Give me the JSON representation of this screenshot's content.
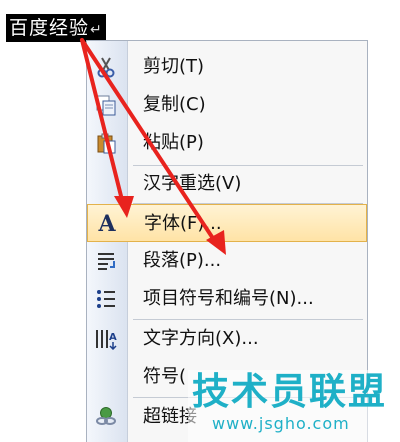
{
  "document": {
    "selected_text": "百度经验",
    "paragraph_mark": "↵"
  },
  "context_menu": {
    "items": [
      {
        "label": "剪切(T)",
        "icon": "scissors-icon"
      },
      {
        "label": "复制(C)",
        "icon": "copy-icon"
      },
      {
        "label": "粘贴(P)",
        "icon": "paste-icon"
      },
      {
        "label": "汉字重选(V)",
        "icon": ""
      },
      {
        "label": "字体(F)...",
        "icon": "font-icon",
        "highlighted": true
      },
      {
        "label": "段落(P)...",
        "icon": "paragraph-icon"
      },
      {
        "label": "项目符号和编号(N)...",
        "icon": "bullet-list-icon"
      },
      {
        "label": "文字方向(X)...",
        "icon": "text-direction-icon"
      },
      {
        "label": "符号(",
        "icon": ""
      },
      {
        "label": "超链接",
        "icon": "hyperlink-icon"
      }
    ]
  },
  "watermark": {
    "title": "技术员联盟",
    "url": "www.jsgho.com"
  },
  "colors": {
    "highlight_fill": "#ffe3a6",
    "arrow": "#e8231e",
    "watermark": "#1fb0c7"
  }
}
